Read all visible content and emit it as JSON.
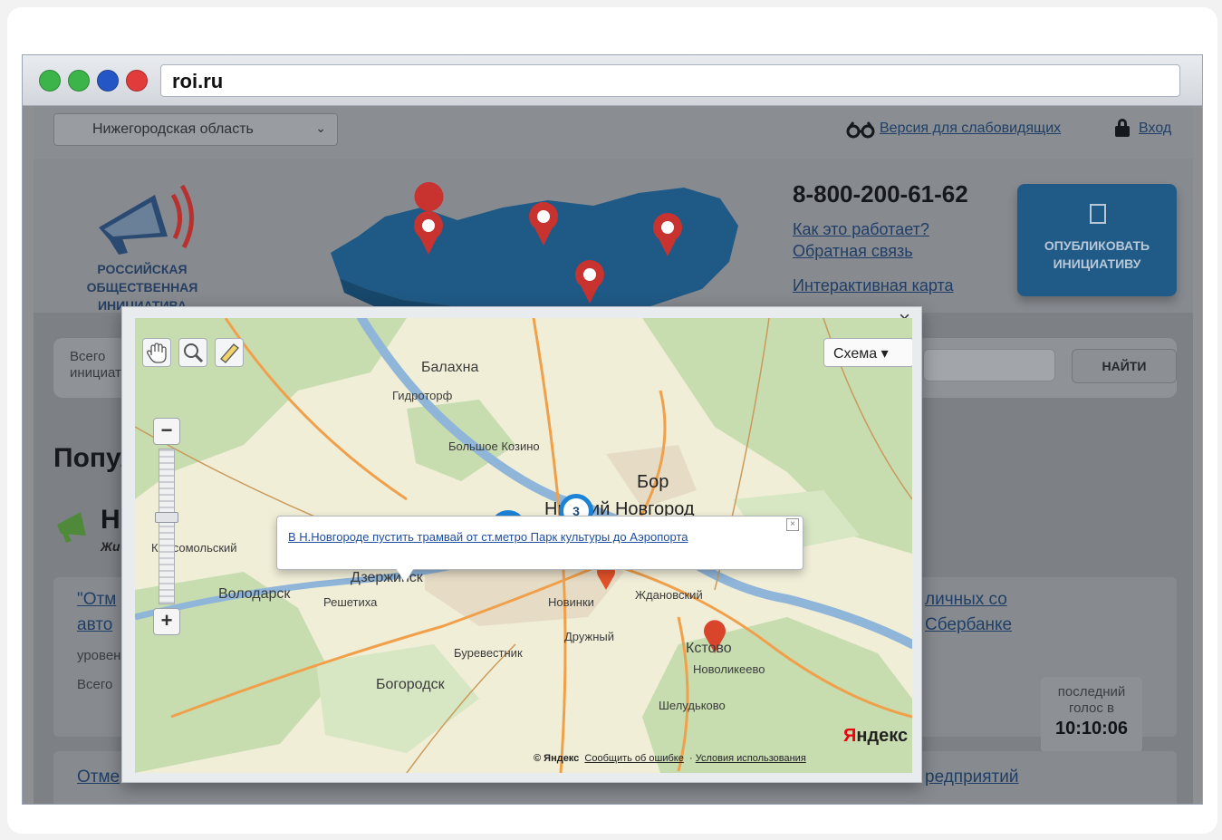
{
  "browser": {
    "url": "roi.ru",
    "dot_colors": [
      "#3cb44a",
      "#3cb44a",
      "#2457c5",
      "#e23b3b"
    ]
  },
  "topbar": {
    "region_select": "Нижегородская область",
    "accessibility_link": "Версия для слабовидящих",
    "login_link": "Вход"
  },
  "header": {
    "logo_lines": [
      "РОССИЙСКАЯ",
      "ОБЩЕСТВЕННАЯ",
      "ИНИЦИАТИВА"
    ],
    "phone": "8-800-200-61-62",
    "how_it_works": "Как это работает?",
    "feedback": "Обратная связь",
    "interactive_map": "Интерактивная карта",
    "publish_button": "ОПУБЛИКОВАТЬ ИНИЦИАТИВУ"
  },
  "search": {
    "total_label": "Всего инициатив",
    "find_button": "НАЙТИ"
  },
  "popular": {
    "title": "Популярные",
    "item_title": "Н",
    "item_sub": "Жи",
    "row1_link_a": "\"Отм",
    "row1_link_b": "авто",
    "row1_level": "уровень",
    "row1_total": "Всего",
    "row1_right_a": "личных со",
    "row1_right_b": "Сбербанке",
    "row2_link": "Отме",
    "row2_right": "редприятий"
  },
  "last_vote": {
    "label_line1": "последний",
    "label_line2": "голос в",
    "time": "10:10:06"
  },
  "map_dialog": {
    "close": "×",
    "scheme_button": "Схема ▾",
    "zoom_out": "−",
    "zoom_in": "+",
    "balloon_link": "В Н.Новгороде пустить трамвай от ст.метро Парк культуры до Аэропорта",
    "balloon_close": "×",
    "cluster_count": "3",
    "labels": {
      "balakhna": "Балахна",
      "gidrotorf": "Гидроторф",
      "bolshoe_kozino": "Большое Козино",
      "bor": "Бор",
      "nizhny": "Нижний Новгород",
      "dzerzhinsk": "Дзержинск",
      "volodarsk": "Володарск",
      "reshetikha": "Решетиха",
      "komsomolsky": "Комсомольский",
      "novinki": "Новинки",
      "zhdanovsky": "Ждановский",
      "druzhny": "Дружный",
      "burevestnik": "Буревестник",
      "kstovo": "Кстово",
      "novolikeevo": "Новоликеево",
      "bogorodsk": "Богородск",
      "sheludyakovo": "Шелудьково"
    },
    "footer_copyright": "© Яндекс",
    "footer_report": "Сообщить об ошибке",
    "footer_terms": "Условия использования",
    "yandex_logo": "Яндекс"
  }
}
